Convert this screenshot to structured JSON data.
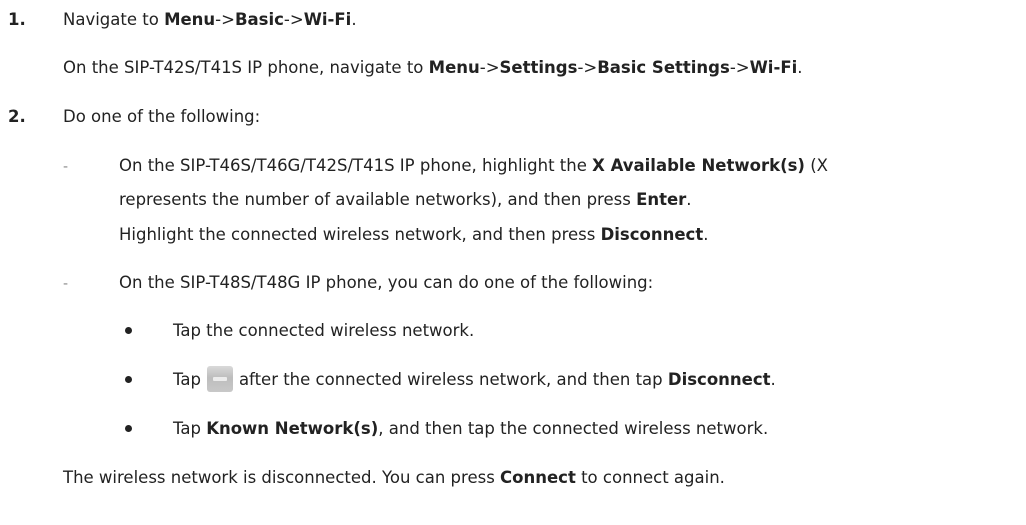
{
  "step1": {
    "number": "1.",
    "pre": "Navigate to ",
    "menu": "Menu",
    "arrow1": "->",
    "basic": "Basic",
    "arrow2": "->",
    "wifi": "Wi-Fi",
    "end": ".",
    "sub_pre": "On the SIP-T42S/T41S IP phone, navigate to ",
    "sub_menu": "Menu",
    "sub_arrow1": "->",
    "sub_settings": "Settings",
    "sub_arrow2": "->",
    "sub_basic_settings": "Basic Settings",
    "sub_arrow3": "->",
    "sub_wifi": "Wi-Fi",
    "sub_end": "."
  },
  "step2": {
    "number": "2.",
    "intro": "Do one of the following:",
    "dash_symbol": "-",
    "option_a": {
      "line1_pre": "On the SIP-T46S/T46G/T42S/T41S IP phone, highlight the ",
      "line1_bold": "X Available Network(s)",
      "line1_post": " (X",
      "line2_pre": "represents the number of available networks), and then press ",
      "line2_bold": "Enter",
      "line2_end": ".",
      "line3_pre": "Highlight the connected wireless network, and then press ",
      "line3_bold": "Disconnect",
      "line3_end": "."
    },
    "option_b": {
      "intro": "On the SIP-T48S/T48G IP phone, you can do one of the following:",
      "bullet1": "Tap the connected wireless network.",
      "bullet2_pre": "Tap",
      "bullet2_icon": "network-detail-icon",
      "bullet2_post": "after the connected wireless network, and then tap ",
      "bullet2_bold": "Disconnect",
      "bullet2_end": ".",
      "bullet3_pre": "Tap ",
      "bullet3_bold": "Known Network(s)",
      "bullet3_post": ", and then tap the connected wireless network."
    }
  },
  "result": {
    "pre": "The wireless network is disconnected. You can press ",
    "bold": "Connect",
    "post": " to connect again."
  }
}
